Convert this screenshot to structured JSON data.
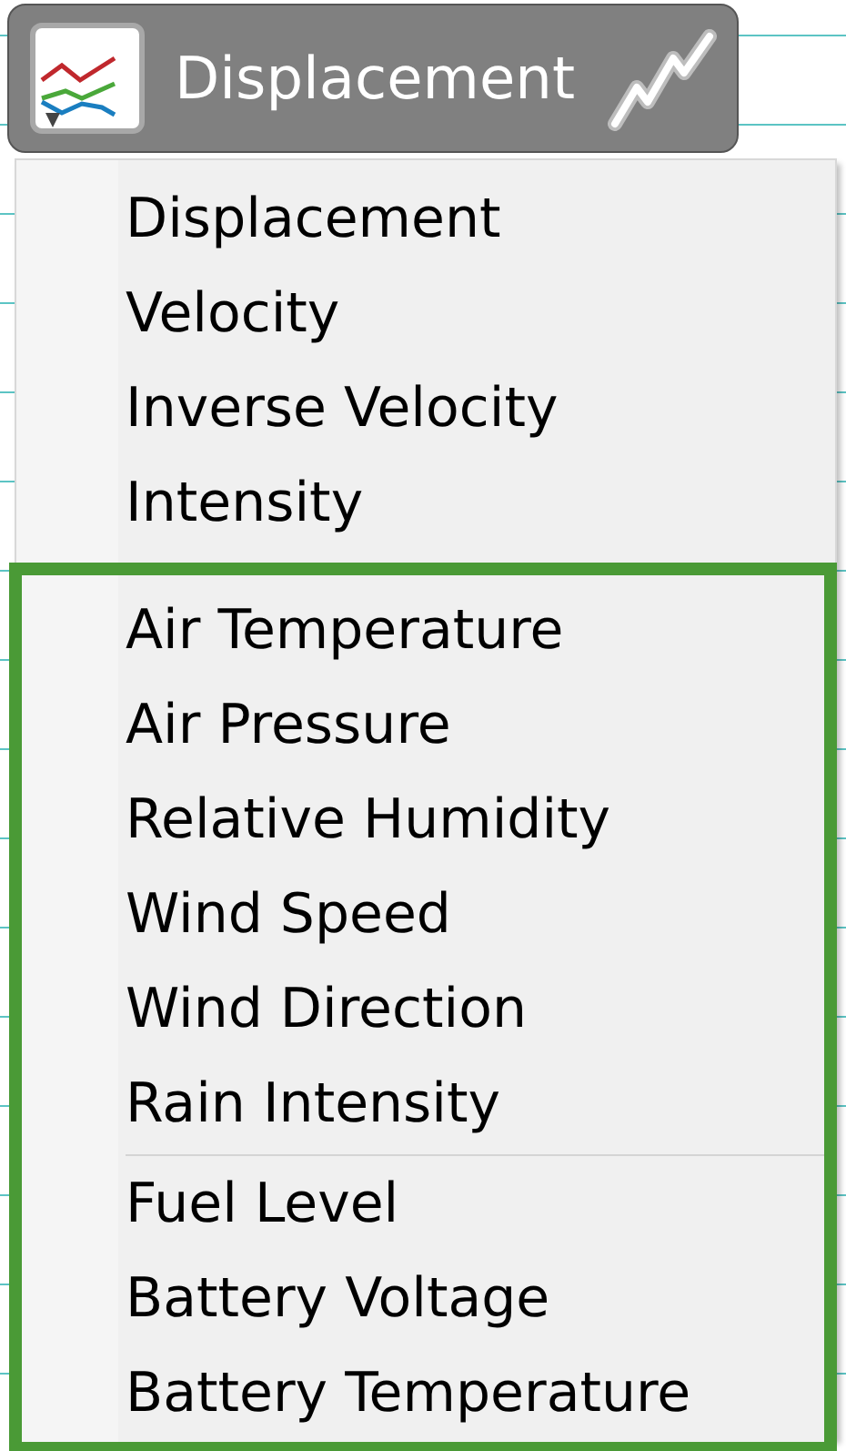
{
  "selector_button": {
    "label": "Displacement"
  },
  "menu": {
    "sections": [
      {
        "highlighted": false,
        "items": [
          "Displacement",
          "Velocity",
          "Inverse Velocity",
          "Intensity"
        ]
      },
      {
        "highlighted": true,
        "items": [
          "Air Temperature",
          "Air Pressure",
          "Relative Humidity",
          "Wind Speed",
          "Wind Direction",
          "Rain Intensity"
        ]
      },
      {
        "highlighted": true,
        "items": [
          "Fuel Level",
          "Battery Voltage",
          "Battery Temperature"
        ]
      }
    ]
  }
}
